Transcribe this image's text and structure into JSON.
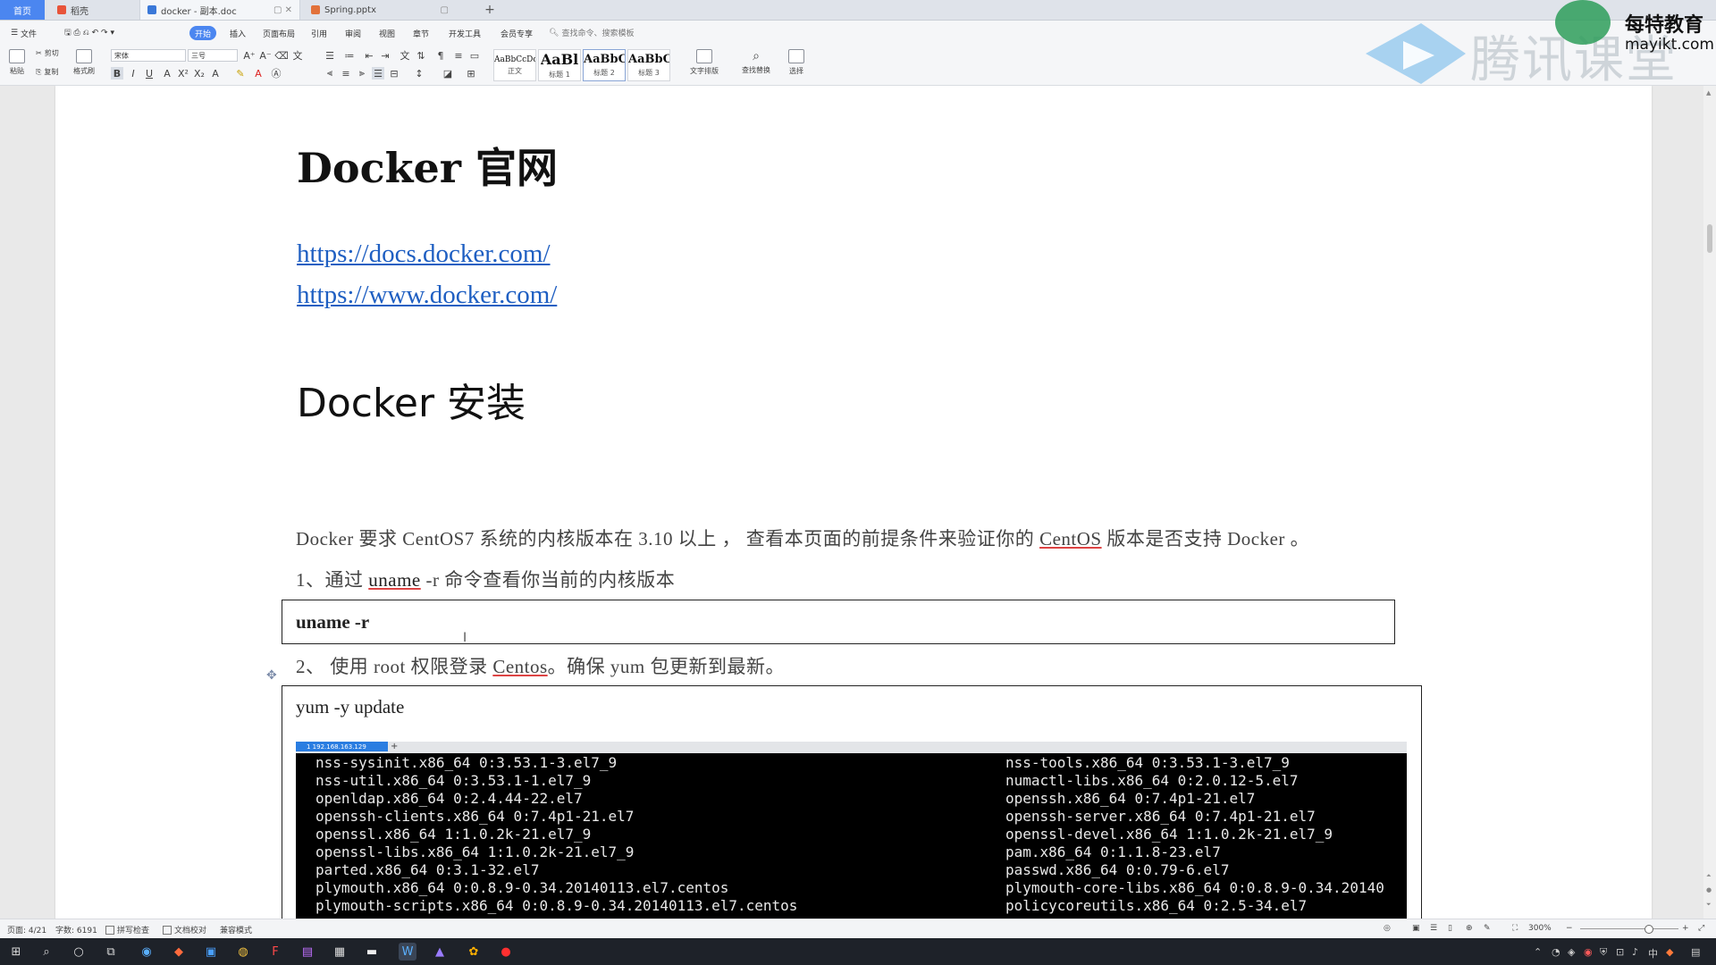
{
  "tabs": {
    "home": "首页",
    "tab1": "稻壳",
    "tab2": "docker - 副本.doc",
    "tab3": "Spring.pptx",
    "add": "+"
  },
  "menu": {
    "file": "文件",
    "items": [
      "开始",
      "插入",
      "页面布局",
      "引用",
      "审阅",
      "视图",
      "章节",
      "开发工具",
      "会员专享"
    ],
    "active": "开始",
    "search_placeholder": "查找命令、搜索模板"
  },
  "ribbon": {
    "paste": "粘贴",
    "cut": "剪切",
    "copy": "复制",
    "format_painter": "格式刷",
    "font_name": "宋体",
    "font_size": "三号",
    "styles": [
      {
        "sample": "AaBbCcDd",
        "label": "正文"
      },
      {
        "sample": "AaBl",
        "label": "标题 1"
      },
      {
        "sample": "AaBbC",
        "label": "标题 2"
      },
      {
        "sample": "AaBbC",
        "label": "标题 3"
      }
    ],
    "text_layout": "文字排版",
    "find_replace": "查找替换",
    "select": "选择"
  },
  "watermark": {
    "logo_text": "腾讯课堂",
    "brand": "每特教育",
    "brand_url": "mayikt.com"
  },
  "document": {
    "heading1": "Docker 官网",
    "links": [
      "https://docs.docker.com/",
      "https://www.docker.com/"
    ],
    "heading2": "Docker 安装",
    "intro_pre": "Docker  要求  CentOS7  系统的内核版本在  3.10 以上 ，  查看本页面的前提条件来验证你的 ",
    "intro_link": "CentOS",
    "intro_post": " 版本是否支持  Docker  。",
    "step1_pre": "1、通过  ",
    "step1_cmd": "uname",
    "step1_post": " -r  命令查看你当前的内核版本",
    "code1": "uname -r",
    "step2_pre": "2、   使用  root  权限登录  ",
    "step2_link": "Centos",
    "step2_post": "。确保  yum  包更新到最新。",
    "code2": "yum -y update"
  },
  "terminal": {
    "tab_label": "1 192.168.163.129",
    "plus": "+",
    "left": [
      "nss-sysinit.x86_64 0:3.53.1-3.el7_9",
      "nss-util.x86_64 0:3.53.1-1.el7_9",
      "openldap.x86_64 0:2.4.44-22.el7",
      "openssh-clients.x86_64 0:7.4p1-21.el7",
      "openssl.x86_64 1:1.0.2k-21.el7_9",
      "openssl-libs.x86_64 1:1.0.2k-21.el7_9",
      "parted.x86_64 0:3.1-32.el7",
      "plymouth.x86_64 0:0.8.9-0.34.20140113.el7.centos",
      "plymouth-scripts.x86_64 0:0.8.9-0.34.20140113.el7.centos"
    ],
    "right": [
      "nss-tools.x86_64 0:3.53.1-3.el7_9",
      "numactl-libs.x86_64 0:2.0.12-5.el7",
      "openssh.x86_64 0:7.4p1-21.el7",
      "openssh-server.x86_64 0:7.4p1-21.el7",
      "openssl-devel.x86_64 1:1.0.2k-21.el7_9",
      "pam.x86_64 0:1.1.8-23.el7",
      "passwd.x86_64 0:0.79-6.el7",
      "plymouth-core-libs.x86_64 0:0.8.9-0.34.20140",
      "policycoreutils.x86_64 0:2.5-34.el7"
    ]
  },
  "status": {
    "page": "页面: 4/21",
    "words": "字数: 6191",
    "spellcheck": "拼写检查",
    "doc_check": "文档校对",
    "compat": "兼容模式",
    "zoom": "300%"
  },
  "colors": {
    "accent": "#4b86f0",
    "link": "#1f5fc2",
    "terminal_bg": "#000000",
    "taskbar": "#1e2229"
  }
}
